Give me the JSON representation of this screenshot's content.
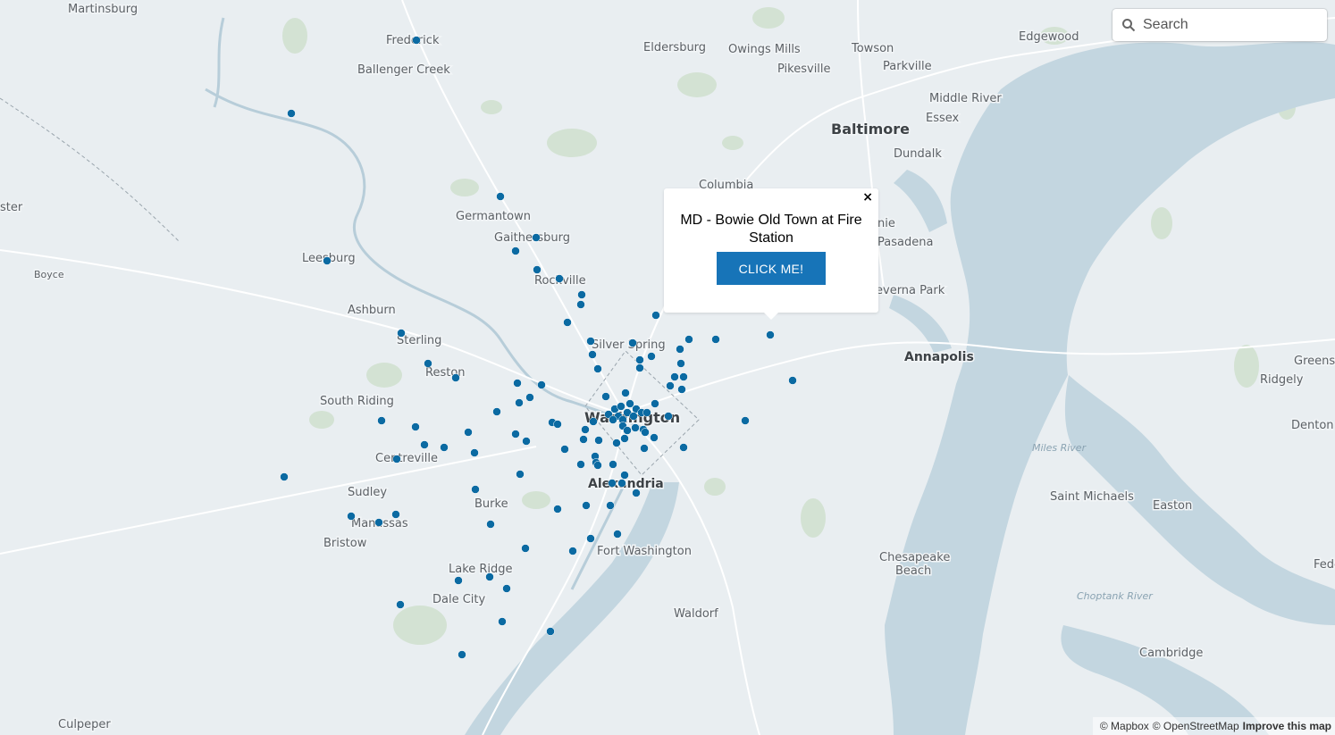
{
  "search": {
    "placeholder": "Search"
  },
  "popup": {
    "title": "MD - Bowie Old Town at Fire Station",
    "button_label": "CLICK ME!",
    "close_label": "×"
  },
  "attribution": {
    "mapbox": "© Mapbox",
    "osm": "© OpenStreetMap",
    "improve": "Improve this map"
  },
  "colors": {
    "marker": "#0b6aa2",
    "water": "#c3d6e0",
    "land": "#e9eef1",
    "park": "#cfdfd0",
    "road": "#ffffff"
  },
  "places": [
    {
      "name": "Martinsburg",
      "kind": "city"
    },
    {
      "name": "Frederick",
      "kind": "city"
    },
    {
      "name": "Ballenger Creek",
      "kind": "city"
    },
    {
      "name": "Eldersburg",
      "kind": "city"
    },
    {
      "name": "Owings Mills",
      "kind": "city"
    },
    {
      "name": "Towson",
      "kind": "city"
    },
    {
      "name": "Edgewood",
      "kind": "city"
    },
    {
      "name": "Pikesville",
      "kind": "city"
    },
    {
      "name": "Parkville",
      "kind": "city"
    },
    {
      "name": "Middle River",
      "kind": "city"
    },
    {
      "name": "Essex",
      "kind": "city"
    },
    {
      "name": "Baltimore",
      "kind": "major"
    },
    {
      "name": "Dundalk",
      "kind": "city"
    },
    {
      "name": "Columbia",
      "kind": "city"
    },
    {
      "name": "ster",
      "kind": "city"
    },
    {
      "name": "Germantown",
      "kind": "city"
    },
    {
      "name": "Gaithersburg",
      "kind": "city"
    },
    {
      "name": "nie",
      "kind": "city"
    },
    {
      "name": "Pasadena",
      "kind": "city"
    },
    {
      "name": "Leesburg",
      "kind": "city"
    },
    {
      "name": "Boyce",
      "kind": "minor"
    },
    {
      "name": "Rockville",
      "kind": "city"
    },
    {
      "name": "everna Park",
      "kind": "city"
    },
    {
      "name": "Ashburn",
      "kind": "city"
    },
    {
      "name": "Sterling",
      "kind": "city"
    },
    {
      "name": "Silver Spring",
      "kind": "city"
    },
    {
      "name": "Annapolis",
      "kind": "major-sm"
    },
    {
      "name": "Greensb",
      "kind": "city"
    },
    {
      "name": "Reston",
      "kind": "city"
    },
    {
      "name": "Ridgely",
      "kind": "city"
    },
    {
      "name": "South Riding",
      "kind": "city"
    },
    {
      "name": "Washington",
      "kind": "major"
    },
    {
      "name": "Denton",
      "kind": "city"
    },
    {
      "name": "Centreville",
      "kind": "city"
    },
    {
      "name": "Alexandria",
      "kind": "major-sm"
    },
    {
      "name": "Sudley",
      "kind": "city"
    },
    {
      "name": "Saint Michaels",
      "kind": "city"
    },
    {
      "name": "Easton",
      "kind": "city"
    },
    {
      "name": "Burke",
      "kind": "city"
    },
    {
      "name": "Manassas",
      "kind": "city"
    },
    {
      "name": "Bristow",
      "kind": "city"
    },
    {
      "name": "Fort Washington",
      "kind": "city"
    },
    {
      "name": "Chesapeake",
      "kind": "city"
    },
    {
      "name": "Beach",
      "kind": "city"
    },
    {
      "name": "Feder",
      "kind": "city"
    },
    {
      "name": "Lake Ridge",
      "kind": "city"
    },
    {
      "name": "Dale City",
      "kind": "city"
    },
    {
      "name": "Waldorf",
      "kind": "city"
    },
    {
      "name": "Cambridge",
      "kind": "city"
    },
    {
      "name": "Culpeper",
      "kind": "city"
    }
  ],
  "water_labels": [
    "Miles River",
    "Choptank River"
  ]
}
